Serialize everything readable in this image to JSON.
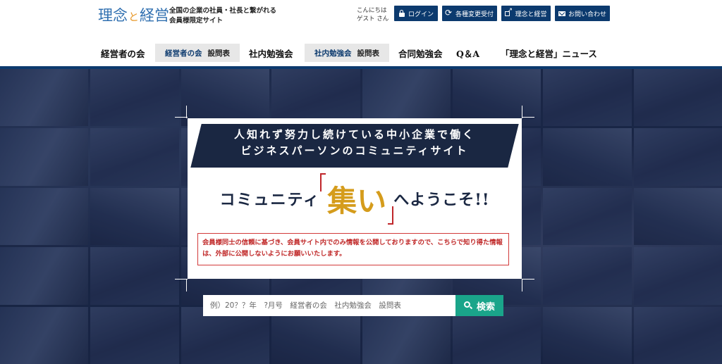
{
  "header": {
    "logo_text_1": "理念",
    "logo_dot": "と",
    "logo_text_2": "経営",
    "tagline_line1": "全国の企業の社員・社長と繋がれる",
    "tagline_line2": "会員様限定サイト",
    "greeting_line1": "こんにちは",
    "greeting_line2": "ゲスト さん",
    "buttons": {
      "login": "ログイン",
      "change_request": "各種変更受付",
      "about": "理念と経営",
      "contact": "お問い合わせ"
    }
  },
  "nav": {
    "item1": "経営者の会",
    "sub1_highlight": "経営者の会",
    "sub1_plain": "設問表",
    "item2": "社内勉強会",
    "sub2_highlight": "社内勉強会",
    "sub2_plain": "設問表",
    "item3": "合同勉強会",
    "item4": "Q＆A",
    "item5": "「理念と経営」ニュース"
  },
  "hero": {
    "banner_line1": "人知れず努力し続けている中小企業で働く",
    "banner_line2": "ビジネスパーソンのコミュニティサイト",
    "welcome_pre": "コミュニティ",
    "welcome_main": "集い",
    "welcome_post": "へようこそ!!",
    "notice": "会員様同士の信頼に基づき、会員サイト内でのみ情報を公開しておりますので、こちらで知り得た情報は、外部に公開しないようにお願いいたします。"
  },
  "search": {
    "placeholder": "例）20？？年　?月号　経営者の会　社内勉強会　設問表",
    "button_label": "検索"
  },
  "colors": {
    "navy": "#0c3a6e",
    "gold": "#d59c1c",
    "red": "#c0262a",
    "teal": "#1aa58a"
  }
}
